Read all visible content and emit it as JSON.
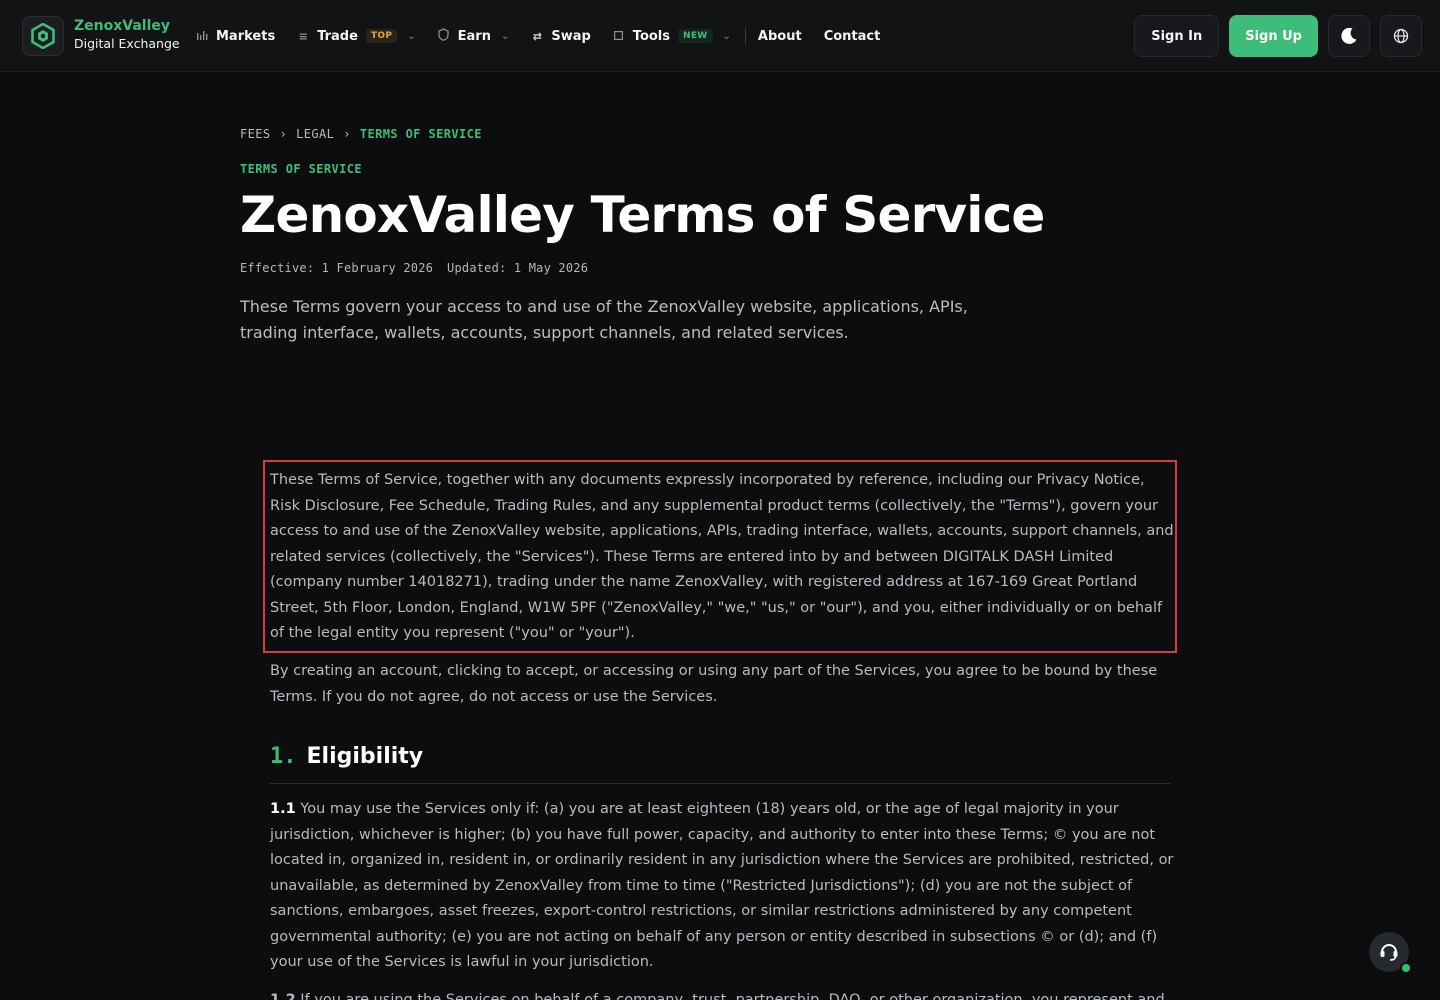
{
  "brand": {
    "name": "ZenoxValley",
    "subtitle": "Digital Exchange"
  },
  "nav": {
    "markets": "Markets",
    "trade": "Trade",
    "trade_badge": "TOP",
    "earn": "Earn",
    "swap": "Swap",
    "tools": "Tools",
    "tools_badge": "NEW",
    "about": "About",
    "contact": "Contact"
  },
  "actions": {
    "sign_in": "Sign In",
    "sign_up": "Sign Up"
  },
  "breadcrumb": {
    "items": [
      "FEES",
      "LEGAL"
    ],
    "separator": "›",
    "current": "TERMS OF SERVICE"
  },
  "page": {
    "eyebrow": "TERMS OF SERVICE",
    "title": "ZenoxValley Terms of Service",
    "effective": "Effective: 1 February 2026",
    "updated": "Updated: 1 May 2026",
    "lede": "These Terms govern your access to and use of the ZenoxValley website, applications, APIs, trading interface, wallets, accounts, support channels, and related services."
  },
  "article": {
    "intro": "These Terms of Service, together with any documents expressly incorporated by reference, including our Privacy Notice, Risk Disclosure, Fee Schedule, Trading Rules, and any supplemental product terms (collectively, the \"Terms\"), govern your access to and use of the ZenoxValley website, applications, APIs, trading interface, wallets, accounts, support channels, and related services (collectively, the \"Services\"). These Terms are entered into by and between DIGITALK DASH Limited (company number 14018271), trading under the name ZenoxValley, with registered address at 167-169 Great Portland Street, 5th Floor, London, England, W1W 5PF (\"ZenoxValley,\" \"we,\" \"us,\" or \"our\"), and you, either individually or on behalf of the legal entity you represent (\"you\" or \"your\").",
    "agreement": "By creating an account, clicking to accept, or accessing or using any part of the Services, you agree to be bound by these Terms. If you do not agree, do not access or use the Services.",
    "section1": {
      "number": "1.",
      "title": "Eligibility",
      "clause_1_1_label": "1.1",
      "clause_1_1": "You may use the Services only if: (a) you are at least eighteen (18) years old, or the age of legal majority in your jurisdiction, whichever is higher; (b) you have full power, capacity, and authority to enter into these Terms; © you are not located in, organized in, resident in, or ordinarily resident in any jurisdiction where the Services are prohibited, restricted, or unavailable, as determined by ZenoxValley from time to time (\"Restricted Jurisdictions\"); (d) you are not the subject of sanctions, embargoes, asset freezes, export-control restrictions, or similar restrictions administered by any competent governmental authority; (e) you are not acting on behalf of any person or entity described in subsections © or (d); and (f) your use of the Services is lawful in your jurisdiction.",
      "clause_1_2_label": "1.2",
      "clause_1_2": "If you are using the Services on behalf of a company, trust, partnership, DAO, or other organization, you represent and"
    }
  },
  "colors": {
    "accent": "#3ebd7a",
    "highlight_border": "#d63a3a",
    "background": "#0c0d0e",
    "badge_top": "#e3a73c"
  },
  "icons": [
    "logo-hex-icon",
    "markets-bars-icon",
    "trade-list-icon",
    "earn-shield-icon",
    "swap-arrows-icon",
    "tools-square-icon",
    "moon-icon",
    "globe-icon",
    "support-chat-icon"
  ]
}
